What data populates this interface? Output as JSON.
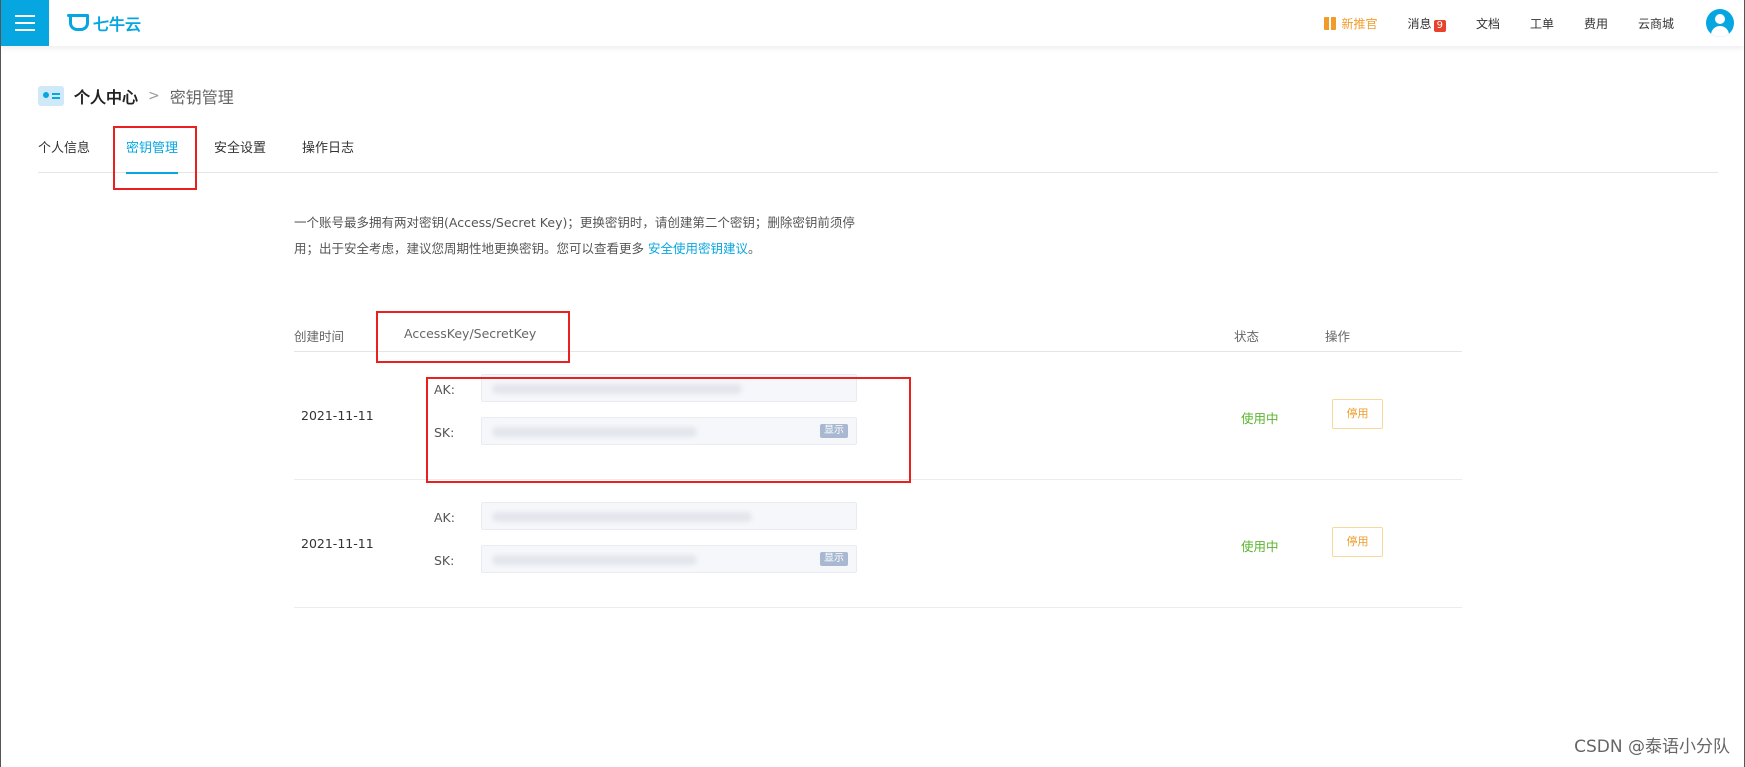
{
  "topbar": {
    "logo_text": "七牛云",
    "nav": {
      "promo": "新推官",
      "messages": "消息",
      "messages_badge": "9",
      "docs": "文档",
      "tickets": "工单",
      "billing": "费用",
      "marketplace": "云商城"
    }
  },
  "breadcrumb": {
    "root": "个人中心",
    "separator": ">",
    "current": "密钥管理"
  },
  "tabs": [
    {
      "label": "个人信息",
      "active": false
    },
    {
      "label": "密钥管理",
      "active": true
    },
    {
      "label": "安全设置",
      "active": false
    },
    {
      "label": "操作日志",
      "active": false
    }
  ],
  "info": {
    "line1": "一个账号最多拥有两对密钥(Access/Secret Key)；更换密钥时，请创建第二个密钥；删除密钥前须停",
    "line2_prefix": "用；出于安全考虑，建议您周期性地更换密钥。您可以查看更多 ",
    "link": "安全使用密钥建议",
    "line2_suffix": "。"
  },
  "table": {
    "headers": {
      "created": "创建时间",
      "keys": "AccessKey/SecretKey",
      "status": "状态",
      "action": "操作"
    },
    "rows": [
      {
        "date": "2021-11-11",
        "ak_label": "AK:",
        "sk_label": "SK:",
        "show_label": "显示",
        "status": "使用中",
        "action": "停用"
      },
      {
        "date": "2021-11-11",
        "ak_label": "AK:",
        "sk_label": "SK:",
        "show_label": "显示",
        "status": "使用中",
        "action": "停用"
      }
    ]
  },
  "watermark": "CSDN @泰语小分队",
  "colors": {
    "brand": "#06a7e1",
    "status_active": "#59b42e",
    "action": "#f29b2a",
    "annotation": "#e82020"
  }
}
